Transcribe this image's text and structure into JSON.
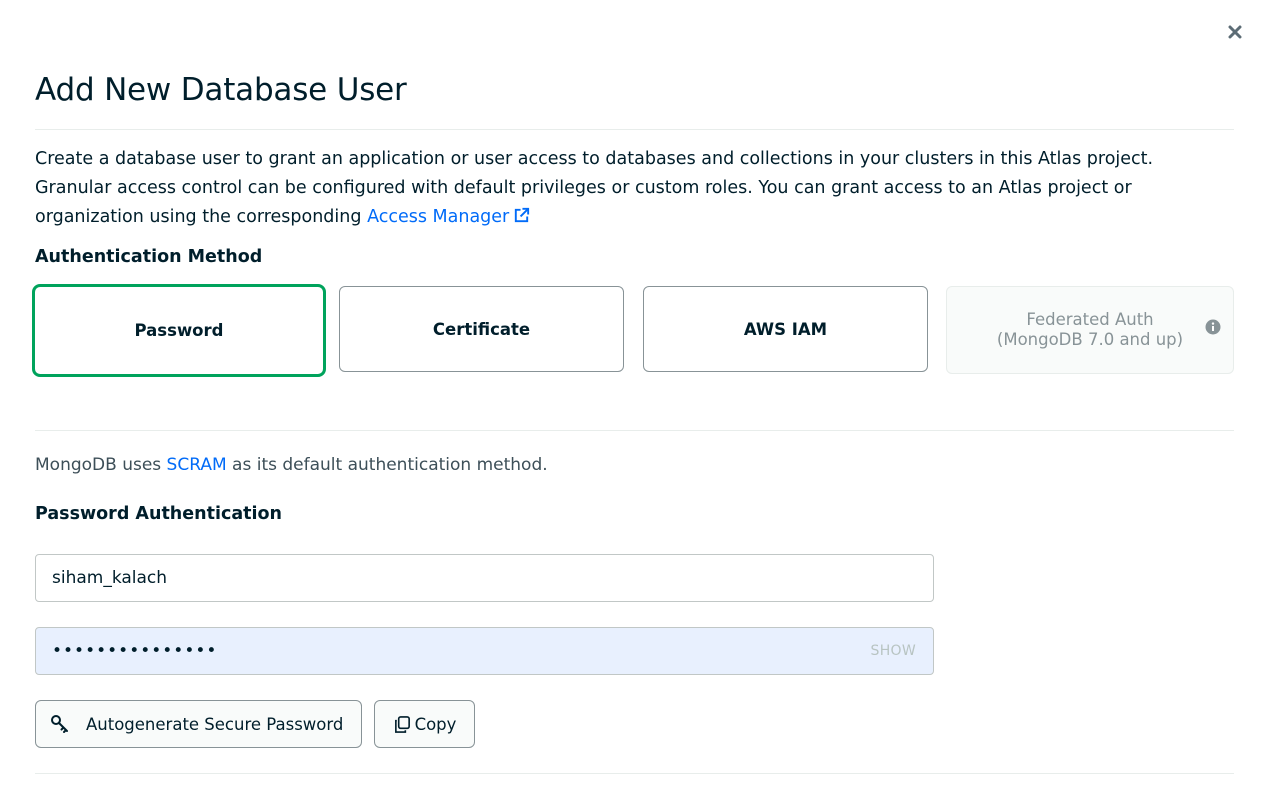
{
  "dialog": {
    "title": "Add New Database User",
    "description_prefix": "Create a database user to grant an application or user access to databases and collections in your clusters in this Atlas project. Granular access control can be configured with default privileges or custom roles. You can grant access to an Atlas project or organization using the corresponding",
    "access_manager_link": "Access Manager",
    "close_icon": "close-icon"
  },
  "auth_method": {
    "label": "Authentication Method",
    "options": [
      {
        "label": "Password",
        "selected": true
      },
      {
        "label": "Certificate",
        "selected": false
      },
      {
        "label": "AWS IAM",
        "selected": false
      },
      {
        "line1": "Federated Auth",
        "line2": "(MongoDB 7.0 and up)",
        "disabled": true
      }
    ]
  },
  "scram_note": {
    "prefix": "MongoDB uses",
    "link": "SCRAM",
    "suffix": "as its default authentication method."
  },
  "password_auth": {
    "label": "Password Authentication",
    "username_value": "siham_kalach",
    "password_value": "•••••••••••••••",
    "show_label": "SHOW",
    "autogen_label": "Autogenerate Secure Password",
    "copy_label": "Copy"
  },
  "colors": {
    "selected_border": "#00a35c",
    "link": "#016bf8",
    "password_bg": "#e8f0fe"
  }
}
